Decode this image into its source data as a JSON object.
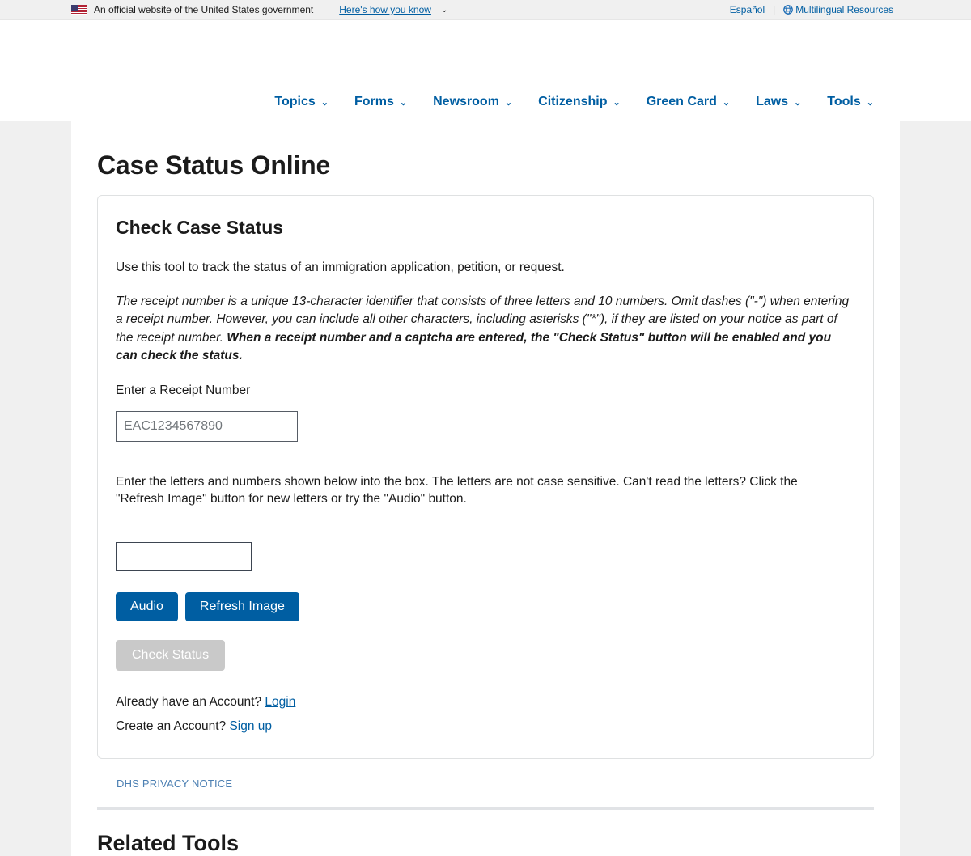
{
  "banner": {
    "flag_icon": "us-flag-icon",
    "official_text": "An official website of the United States government",
    "how_you_know": "Here's how you know",
    "caret": "⌄",
    "espanol": "Español",
    "separator": "|",
    "globe_icon": "globe-icon",
    "multilingual": "Multilingual Resources"
  },
  "nav": {
    "items": [
      {
        "label": "Topics",
        "caret": "⌄"
      },
      {
        "label": "Forms",
        "caret": "⌄"
      },
      {
        "label": "Newsroom",
        "caret": "⌄"
      },
      {
        "label": "Citizenship",
        "caret": "⌄"
      },
      {
        "label": "Green Card",
        "caret": "⌄"
      },
      {
        "label": "Laws",
        "caret": "⌄"
      },
      {
        "label": "Tools",
        "caret": "⌄"
      }
    ]
  },
  "page": {
    "title": "Case Status Online"
  },
  "card": {
    "title": "Check Case Status",
    "intro": "Use this tool to track the status of an immigration application, petition, or request.",
    "note_part1": "The receipt number is a unique 13-character identifier that consists of three letters and 10 numbers. Omit dashes (\"-\") when entering a receipt number. However, you can include all other characters, including asterisks (\"*\"), if they are listed on your notice as part of the receipt number. ",
    "note_bold": "When a receipt number and a captcha are entered, the \"Check Status\" button will be enabled and you can check the status.",
    "receipt_label": "Enter a Receipt Number",
    "receipt_placeholder": "EAC1234567890",
    "receipt_value": "",
    "captcha_instructions": "Enter the letters and numbers shown below into the box. The letters are not case sensitive. Can't read the letters? Click the \"Refresh Image\" button for new letters or try the \"Audio\" button.",
    "captcha_value": "",
    "audio_button": "Audio",
    "refresh_button": "Refresh Image",
    "check_status_button": "Check Status",
    "login_prompt": "Already have an Account? ",
    "login_link": "Login",
    "signup_prompt": "Create an Account? ",
    "signup_link": "Sign up"
  },
  "footer": {
    "privacy_notice": "DHS PRIVACY NOTICE",
    "related_tools_title": "Related Tools"
  },
  "colors": {
    "primary_blue": "#005ea2",
    "link_blue": "#4d80b3",
    "disabled_gray": "#c9c9c9",
    "page_bg": "#f0f0f0",
    "text": "#1b1b1b"
  }
}
